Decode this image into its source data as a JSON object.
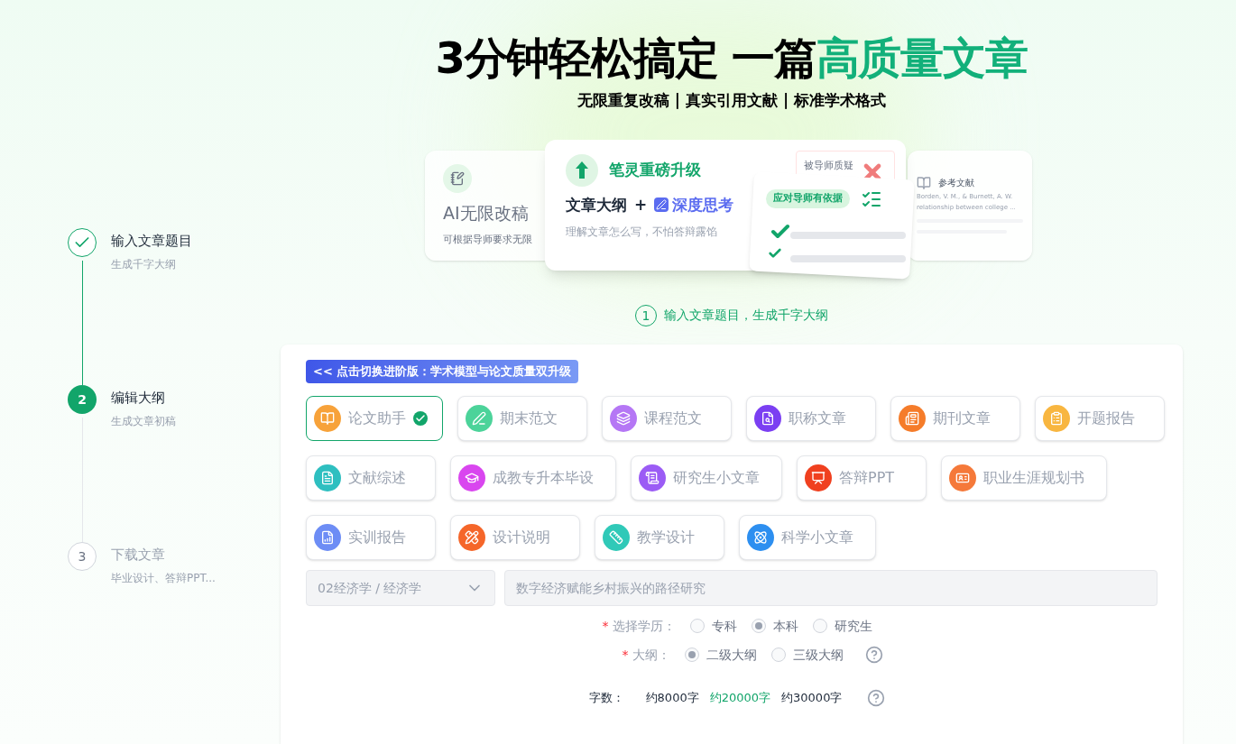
{
  "steps": [
    {
      "kind": "done",
      "title": "输入文章题目",
      "subtitle": "生成千字大纲"
    },
    {
      "kind": "active",
      "marker": "2",
      "title": "编辑大纲",
      "subtitle": "生成文章初稿"
    },
    {
      "kind": "pending",
      "marker": "3",
      "title": "下载文章",
      "subtitle": "毕业设计、答辩PPT..."
    }
  ],
  "headline": {
    "plain": "3分钟轻松搞定 一篇",
    "accent": "高质量文章"
  },
  "tagline": "无限重复改稿 | 真实引用文献 | 标准学术格式",
  "hero": {
    "left": {
      "title": "AI无限改稿",
      "desc": "可根据导师要求无限"
    },
    "main": {
      "title": "笔灵重磅升级",
      "line_a": "文章大纲",
      "plus": "+",
      "line_b": "深度思考",
      "desc": "理解文章怎么写，不怕答辩露馅"
    },
    "doubt": "被导师质疑",
    "badge": "应对导师有依据",
    "ref": {
      "title": "参考文献",
      "lines": [
        "Borden, V. M., & Burnett, A. W.",
        "relationship between college ..."
      ]
    }
  },
  "step_caption": {
    "number": "1",
    "text": "输入文章题目，生成千字大纲"
  },
  "banner": "<< 点击切换进阶版：学术模型与论文质量双升级",
  "doc_types": [
    {
      "label": "论文助手",
      "color": "#f7a23a",
      "selected": true
    },
    {
      "label": "期末范文",
      "color": "#4cd39a",
      "selected": false
    },
    {
      "label": "课程范文",
      "color": "#b577f5",
      "selected": false
    },
    {
      "label": "职称文章",
      "color": "#7b3ff2",
      "selected": false
    },
    {
      "label": "期刊文章",
      "color": "#f57c2a",
      "selected": false
    },
    {
      "label": "开题报告",
      "color": "#f8b640",
      "selected": false
    },
    {
      "label": "文献综述",
      "color": "#2ebfc0",
      "selected": false
    },
    {
      "label": "成教专升本毕设",
      "color": "#d946ef",
      "selected": false
    },
    {
      "label": "研究生小文章",
      "color": "#9b5cf5",
      "selected": false
    },
    {
      "label": "答辩PPT",
      "color": "#f0401f",
      "selected": false
    },
    {
      "label": "职业生涯规划书",
      "color": "#f5793a",
      "selected": false
    },
    {
      "label": "实训报告",
      "color": "#6d8df5",
      "selected": false
    },
    {
      "label": "设计说明",
      "color": "#f5662a",
      "selected": false
    },
    {
      "label": "教学设计",
      "color": "#30c9b8",
      "selected": false
    },
    {
      "label": "科学小文章",
      "color": "#2d8ff0",
      "selected": false
    }
  ],
  "subject_select": {
    "value": "02经济学 / 经济学"
  },
  "topic_field": {
    "placeholder": "数字经济赋能乡村振兴的路径研究"
  },
  "education": {
    "required_mark": "*",
    "label": "选择学历：",
    "options": [
      {
        "label": "专科",
        "selected": false
      },
      {
        "label": "本科",
        "selected": true
      },
      {
        "label": "研究生",
        "selected": false
      }
    ]
  },
  "outline": {
    "required_mark": "*",
    "label": "大纲：",
    "options": [
      {
        "label": "二级大纲",
        "selected": true
      },
      {
        "label": "三级大纲",
        "selected": false
      }
    ]
  },
  "word_count": {
    "label": "字数：",
    "options": [
      {
        "label": "约8000字",
        "selected": false
      },
      {
        "label": "约20000字",
        "selected": true
      },
      {
        "label": "约30000字",
        "selected": false
      }
    ]
  }
}
